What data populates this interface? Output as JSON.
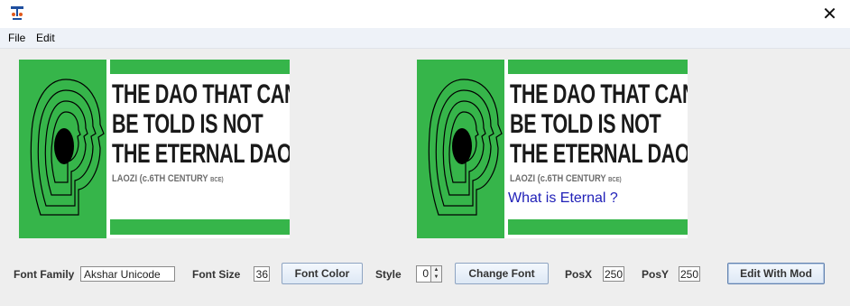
{
  "window": {
    "close_glyph": "✕",
    "icon": "java-app-icon"
  },
  "menu": {
    "items": [
      "File",
      "Edit"
    ]
  },
  "images": [
    {
      "quote_lines": [
        "THE DAO THAT CAN",
        "BE TOLD IS NOT",
        "THE ETERNAL DAO"
      ],
      "author": "LAOZI (c.6TH CENTURY",
      "era": "BCE)",
      "overlay_text": ""
    },
    {
      "quote_lines": [
        "THE DAO THAT CAN",
        "BE TOLD IS NOT",
        "THE ETERNAL DAO"
      ],
      "author": "LAOZI (c.6TH CENTURY",
      "era": "BCE)",
      "overlay_text": "What is Eternal ?"
    }
  ],
  "controls": {
    "font_family_label": "Font Family",
    "font_family_value": "Akshar Unicode",
    "font_size_label": "Font Size",
    "font_size_value": "36",
    "font_color_button": "Font Color",
    "style_label": "Style",
    "style_value": "0",
    "change_font_button": "Change Font",
    "posx_label": "PosX",
    "posx_value": "250",
    "posy_label": "PosY",
    "posy_value": "250",
    "edit_button": "Edit With Mod"
  },
  "colors": {
    "green": "#36b54a",
    "overlay_text": "#2121b8"
  }
}
